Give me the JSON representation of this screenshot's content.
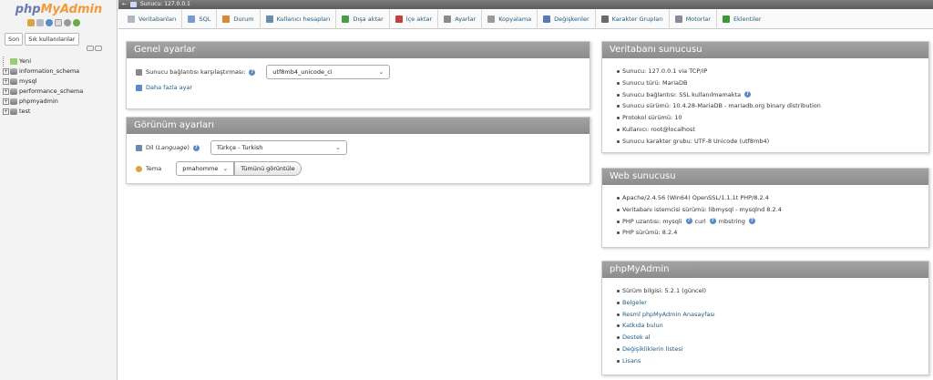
{
  "nav": {
    "logo_php": "php",
    "logo_my": "MyAdmin",
    "tab_recent": "Son",
    "tab_favorites": "Sık kullanılanlar",
    "tree": [
      {
        "label": "Yeni",
        "type": "new"
      },
      {
        "label": "information_schema",
        "type": "db"
      },
      {
        "label": "mysql",
        "type": "db"
      },
      {
        "label": "performance_schema",
        "type": "db"
      },
      {
        "label": "phpmyadmin",
        "type": "db"
      },
      {
        "label": "test",
        "type": "db"
      }
    ]
  },
  "serverbar": {
    "label": "Sunucu: 127.0.0.1"
  },
  "menubar": {
    "tabs": [
      {
        "label": "Veritabanları",
        "icon": "database-icon",
        "color": "#b0b8c8"
      },
      {
        "label": "SQL",
        "icon": "sql-icon",
        "color": "#7a9ad0"
      },
      {
        "label": "Durum",
        "icon": "status-icon",
        "color": "#d08a3a"
      },
      {
        "label": "Kullanıcı hesapları",
        "icon": "users-icon",
        "color": "#6a8ab0"
      },
      {
        "label": "Dışa aktar",
        "icon": "export-icon",
        "color": "#4a9a4a"
      },
      {
        "label": "İçe aktar",
        "icon": "import-icon",
        "color": "#c04040"
      },
      {
        "label": "Ayarlar",
        "icon": "wrench-icon",
        "color": "#8a8a8a"
      },
      {
        "label": "Kopyalama",
        "icon": "replication-icon",
        "color": "#9a9a9a"
      },
      {
        "label": "Değişkenler",
        "icon": "variables-icon",
        "color": "#5a7ab0"
      },
      {
        "label": "Karakter Grupları",
        "icon": "charset-icon",
        "color": "#6a6a6a"
      },
      {
        "label": "Motorlar",
        "icon": "engines-icon",
        "color": "#8a8a9a"
      },
      {
        "label": "Eklentiler",
        "icon": "plugins-icon",
        "color": "#3a9a3a"
      }
    ]
  },
  "general": {
    "title": "Genel ayarlar",
    "collation_label": "Sunucu bağlantısı karşılaştırması:",
    "collation_value": "utf8mb4_unicode_ci",
    "more_settings": "Daha fazla ayar"
  },
  "appearance": {
    "title": "Görünüm ayarları",
    "language_label_prefix": "Dil (",
    "language_label_em": "Language",
    "language_label_suffix": ")",
    "language_value": "Türkçe - Turkish",
    "theme_label": "Tema",
    "theme_value": "pmahomme",
    "view_all": "Tümünü görüntüle"
  },
  "db_server": {
    "title": "Veritabanı sunucusu",
    "items": [
      "Sunucu: 127.0.0.1 via TCP/IP",
      "Sunucu türü: MariaDB",
      "Sunucu bağlantısı: SSL kullanılmamakta",
      "Sunucu sürümü: 10.4.28-MariaDB - mariadb.org binary distribution",
      "Protokol sürümü: 10",
      "Kullanıcı: root@localhost",
      "Sunucu karakter grubu: UTF-8 Unicode (utf8mb4)"
    ]
  },
  "web_server": {
    "title": "Web sunucusu",
    "items": [
      "Apache/2.4.56 (Win64) OpenSSL/1.1.1t PHP/8.2.4",
      "Veritabanı istemcisi sürümü: libmysql - mysqlnd 8.2.4",
      "PHP uzantısı: mysqli",
      "curl",
      "mbstring",
      "PHP sürümü: 8.2.4"
    ]
  },
  "pma": {
    "title": "phpMyAdmin",
    "version": "Sürüm bilgisi: 5.2.1 (güncel)",
    "links": [
      "Belgeler",
      "Resmî phpMyAdmin Anasayfası",
      "Katkıda bulun",
      "Destek al",
      "Değişikliklerin listesi",
      "Lisans"
    ]
  },
  "colors": {
    "link": "#235a81",
    "panel_header": "#999999",
    "logo_blue": "#6c78af",
    "logo_orange": "#f29a3a"
  }
}
